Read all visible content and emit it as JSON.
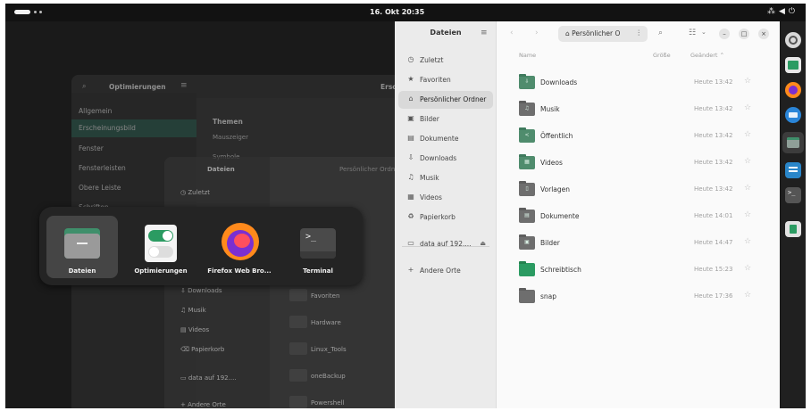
{
  "topbar": {
    "clock": "16. Okt  20:35",
    "tray_icons": [
      "network-icon",
      "volume-icon",
      "power-icon"
    ]
  },
  "tweaks_window": {
    "title": "Optimierungen",
    "header_right": "Ersc",
    "sections": [
      "Allgemein",
      "Erscheinungsbild",
      "Fenster",
      "Fensterleisten",
      "Obere Leiste",
      "Schriften"
    ],
    "selected_index": 1,
    "content_heading": "Themen",
    "content_items": [
      "Mauszeiger",
      "Symbole"
    ]
  },
  "files_background": {
    "title": "Dateien",
    "sidebar": [
      "Zuletzt",
      "Downloads",
      "Musik",
      "Videos",
      "Papierkorb",
      "data auf 192....",
      "Andere Orte"
    ],
    "breadcrumb": "Persönlicher Ordner",
    "folders": [
      "Favoriten",
      "Hardware",
      "Linux_Tools",
      "oneBackup",
      "Powershell"
    ]
  },
  "switcher": {
    "apps": [
      {
        "label": "Dateien",
        "icon": "files-icon",
        "selected": true
      },
      {
        "label": "Optimierungen",
        "icon": "tweaks-toggle-icon",
        "selected": false
      },
      {
        "label": "Firefox Web Bro...",
        "icon": "firefox-icon",
        "selected": false
      },
      {
        "label": "Terminal",
        "icon": "terminal-icon",
        "selected": false
      }
    ]
  },
  "files": {
    "title": "Dateien",
    "path_label": "Persönlicher O",
    "sidebar": [
      {
        "label": "Zuletzt",
        "icon": "clock-icon"
      },
      {
        "label": "Favoriten",
        "icon": "star-icon"
      },
      {
        "label": "Persönlicher Ordner",
        "icon": "home-icon"
      },
      {
        "label": "Bilder",
        "icon": "image-icon"
      },
      {
        "label": "Dokumente",
        "icon": "document-icon"
      },
      {
        "label": "Downloads",
        "icon": "download-icon"
      },
      {
        "label": "Musik",
        "icon": "music-icon"
      },
      {
        "label": "Videos",
        "icon": "video-icon"
      },
      {
        "label": "Papierkorb",
        "icon": "trash-icon"
      }
    ],
    "selected_sidebar_index": 2,
    "network": {
      "label": "data auf 192....",
      "icon": "network-drive-icon"
    },
    "other_places": {
      "label": "Andere Orte",
      "icon": "plus-icon"
    },
    "columns": {
      "name": "Name",
      "size": "Größe",
      "modified": "Geändert"
    },
    "rows": [
      {
        "name": "Downloads",
        "modified": "Heute 13:42",
        "icon": "download-folder-icon"
      },
      {
        "name": "Musik",
        "modified": "Heute 13:42",
        "icon": "music-folder-icon"
      },
      {
        "name": "Öffentlich",
        "modified": "Heute 13:42",
        "icon": "public-folder-icon"
      },
      {
        "name": "Videos",
        "modified": "Heute 13:42",
        "icon": "video-folder-icon"
      },
      {
        "name": "Vorlagen",
        "modified": "Heute 13:42",
        "icon": "templates-folder-icon"
      },
      {
        "name": "Dokumente",
        "modified": "Heute 14:01",
        "icon": "documents-folder-icon"
      },
      {
        "name": "Bilder",
        "modified": "Heute 14:47",
        "icon": "pictures-folder-icon"
      },
      {
        "name": "Schreibtisch",
        "modified": "Heute 15:23",
        "icon": "desktop-folder-icon"
      },
      {
        "name": "snap",
        "modified": "Heute 17:36",
        "icon": "folder-icon"
      }
    ]
  },
  "dock": {
    "items": [
      "ubuntu-settings-icon",
      "files-alt-icon",
      "firefox-icon",
      "thunderbird-icon",
      "files-icon",
      "text-editor-icon",
      "terminal-icon",
      "trash-icon"
    ],
    "selected_index": 4
  },
  "colors": {
    "accent": "#4f8c6d",
    "folder_green": "#2b9b62",
    "selected_bg": "#d9d9d9"
  }
}
